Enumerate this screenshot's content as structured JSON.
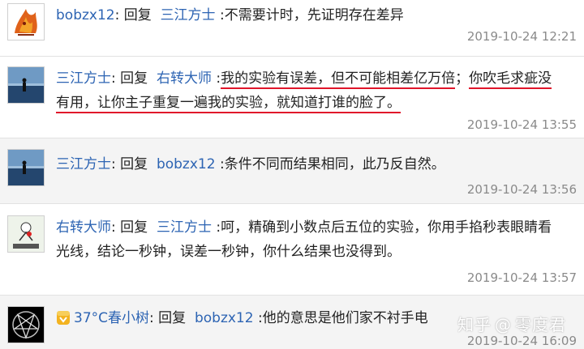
{
  "comments": [
    {
      "author": "bobzx12",
      "reply_word": "回复",
      "target": "三江方士",
      "text": ":不需要计时，先证明存在差异",
      "timestamp": "2019-10-24 12:21",
      "avatar_icon": "flame-creature-icon"
    },
    {
      "author": "三江方士",
      "reply_word": "回复",
      "target": "右转大师",
      "text_line1_pre": ":",
      "text_line1_a": "我的实验有误差，但不可能相差亿万倍",
      "text_line1_mid": "；",
      "text_line1_b": "你吹毛求疵没",
      "text_line2": "有用，让你主子重复一遍我的实验，就知道打谁的脸了。",
      "timestamp": "2019-10-24 13:55",
      "avatar_icon": "seaside-person-icon"
    },
    {
      "author": "三江方士",
      "reply_word": "回复",
      "target": "bobzx12",
      "text": ":条件不同而结果相同，此乃反自然。",
      "timestamp": "2019-10-24 13:56",
      "avatar_icon": "seaside-person-icon"
    },
    {
      "author": "右转大师",
      "reply_word": "回复",
      "target": "三江方士",
      "text_line1": ":呵，精确到小数点后五位的实验，你用手掐秒表眼睛看",
      "text_line2": "光线，结论一秒钟，误差一秒钟，你什么结果也没得到。",
      "timestamp": "2019-10-24 13:57",
      "avatar_icon": "cartoon-figure-icon"
    },
    {
      "author": "37°C春小树",
      "reply_word": "回复",
      "target": "bobzx12",
      "text": ":他的意思是他们家不衬手电",
      "timestamp": "2019-10-24 16:09",
      "avatar_icon": "pentagram-icon",
      "badge_icon": "vip-badge-icon"
    }
  ],
  "watermark": {
    "site": "知乎",
    "at": "@",
    "user": "零度君"
  },
  "colors": {
    "link": "#2d64b3",
    "underline": "#e0152a",
    "timestamp": "#8a8a8a",
    "shaded_bg": "#f4f4f4"
  }
}
